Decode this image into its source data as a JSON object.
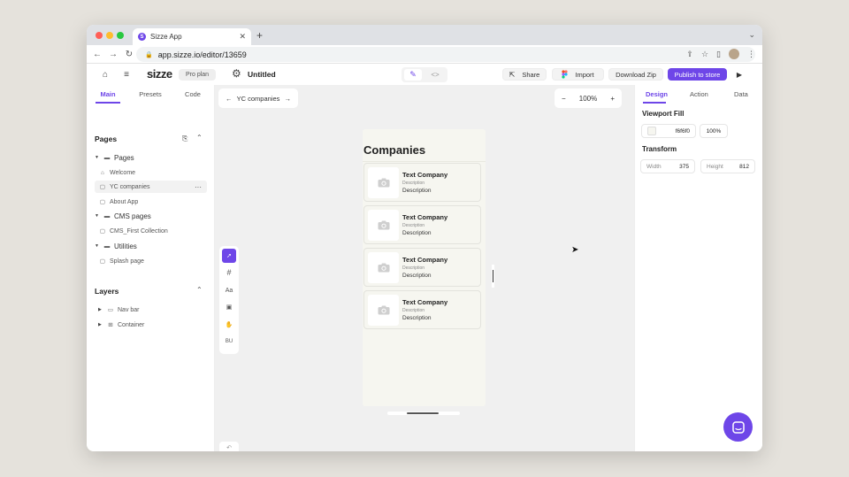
{
  "browser": {
    "tab_title": "Sizze App",
    "tab_favicon_letter": "S",
    "url": "app.sizze.io/editor/13659"
  },
  "header": {
    "logo": "sizze",
    "plan": "Pro plan",
    "project_title": "Untitled",
    "share_label": "Share",
    "import_label": "Import",
    "download_label": "Download Zip",
    "publish_label": "Publish to store"
  },
  "left_panel": {
    "tabs": [
      "Main",
      "Presets",
      "Code"
    ],
    "pages_heading": "Pages",
    "pages": [
      {
        "label": "Pages"
      },
      {
        "label": "Welcome"
      },
      {
        "label": "YC companies"
      },
      {
        "label": "About App"
      },
      {
        "label": "CMS pages"
      },
      {
        "label": "CMS_First Collection"
      },
      {
        "label": "Utilities"
      },
      {
        "label": "Splash page"
      }
    ],
    "layers_heading": "Layers",
    "layers": [
      {
        "label": "Nav bar"
      },
      {
        "label": "Container"
      }
    ]
  },
  "canvas": {
    "current_page": "YC companies",
    "zoom": "100%",
    "zoom_minus": "−",
    "zoom_plus": "+",
    "frame_title": "Companies",
    "cards": [
      {
        "title": "Text Company",
        "subtitle": "Description",
        "description": "Description"
      },
      {
        "title": "Text Company",
        "subtitle": "Description",
        "description": "Description"
      },
      {
        "title": "Text Company",
        "subtitle": "Description",
        "description": "Description"
      },
      {
        "title": "Text Company",
        "subtitle": "Description",
        "description": "Description"
      }
    ],
    "tools": [
      "cursor-icon",
      "frame-icon",
      "text-tool",
      "image-icon",
      "hand-icon",
      "bu-tool"
    ],
    "text_tool_label": "Aa",
    "bu_tool_label": "BU"
  },
  "right_panel": {
    "tabs": [
      "Design",
      "Action",
      "Data"
    ],
    "viewport_fill_label": "Viewport Fill",
    "fill_hex": "f6f6f0",
    "fill_opacity": "100%",
    "transform_label": "Transform",
    "width_label": "Width",
    "width_value": "375",
    "height_label": "Height",
    "height_value": "812"
  },
  "colors": {
    "accent": "#6e46e8",
    "frame_bg": "#f6f6f0"
  }
}
